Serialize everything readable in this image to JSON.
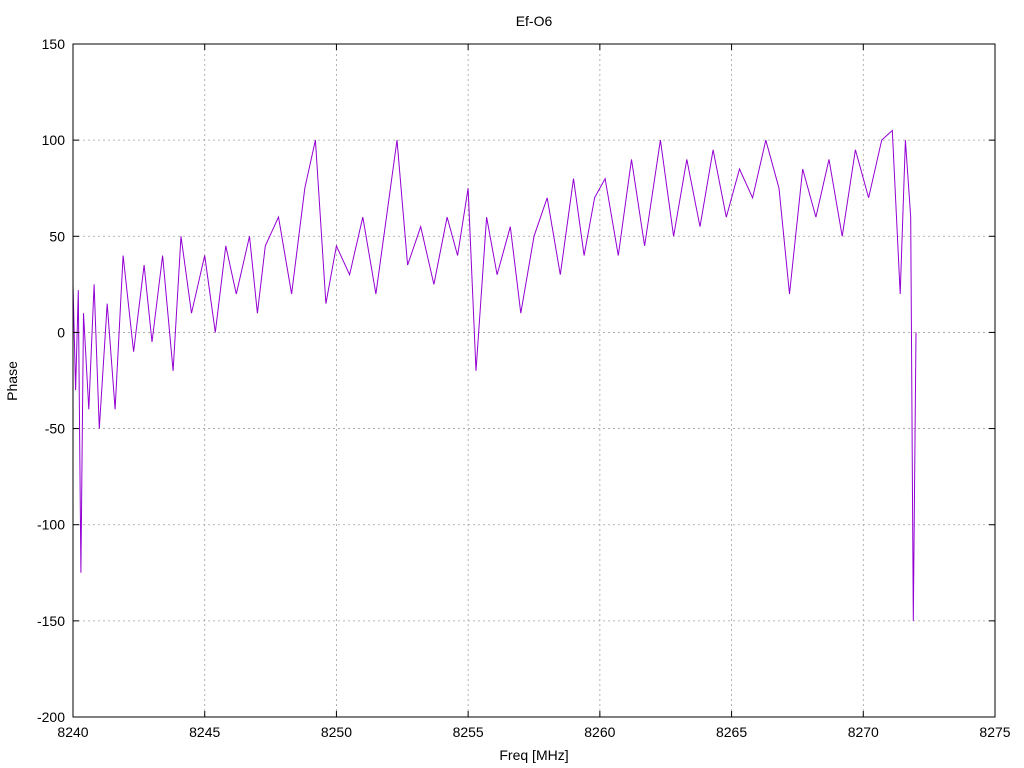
{
  "chart_data": {
    "type": "line",
    "title": "Ef-O6",
    "xlabel": "Freq [MHz]",
    "ylabel": "Phase",
    "xlim": [
      8240,
      8275
    ],
    "ylim": [
      -200,
      150
    ],
    "xticks": [
      8240,
      8245,
      8250,
      8255,
      8260,
      8265,
      8270,
      8275
    ],
    "yticks": [
      -200,
      -150,
      -100,
      -50,
      0,
      50,
      100,
      150
    ],
    "grid": true,
    "legend": "none",
    "series": [
      {
        "color": "#9400d3",
        "x": [
          8240.0,
          8240.1,
          8240.2,
          8240.3,
          8240.4,
          8240.6,
          8240.8,
          8241.0,
          8241.3,
          8241.6,
          8241.9,
          8242.3,
          8242.7,
          8243.0,
          8243.4,
          8243.8,
          8244.1,
          8244.5,
          8245.0,
          8245.4,
          8245.8,
          8246.2,
          8246.7,
          8247.0,
          8247.3,
          8247.8,
          8248.3,
          8248.8,
          8249.2,
          8249.6,
          8250.0,
          8250.5,
          8251.0,
          8251.5,
          8252.0,
          8252.3,
          8252.7,
          8253.2,
          8253.7,
          8254.2,
          8254.6,
          8255.0,
          8255.3,
          8255.7,
          8256.1,
          8256.6,
          8257.0,
          8257.5,
          8258.0,
          8258.5,
          8259.0,
          8259.4,
          8259.8,
          8260.2,
          8260.7,
          8261.2,
          8261.7,
          8262.3,
          8262.8,
          8263.3,
          8263.8,
          8264.3,
          8264.8,
          8265.3,
          8265.8,
          8266.3,
          8266.8,
          8267.2,
          8267.7,
          8268.2,
          8268.7,
          8269.2,
          8269.7,
          8270.2,
          8270.7,
          8271.1,
          8271.4,
          8271.6,
          8271.8,
          8271.9,
          8272.0
        ],
        "y": [
          25,
          -30,
          22,
          -125,
          10,
          -40,
          25,
          -50,
          15,
          -40,
          40,
          -10,
          35,
          -5,
          40,
          -20,
          50,
          10,
          40,
          0,
          45,
          20,
          50,
          10,
          45,
          60,
          20,
          75,
          100,
          15,
          45,
          30,
          60,
          20,
          70,
          100,
          35,
          55,
          25,
          60,
          40,
          75,
          -20,
          60,
          30,
          55,
          10,
          50,
          70,
          30,
          80,
          40,
          70,
          80,
          40,
          90,
          45,
          100,
          50,
          90,
          55,
          95,
          60,
          85,
          70,
          100,
          75,
          20,
          85,
          60,
          90,
          50,
          95,
          70,
          100,
          105,
          20,
          100,
          60,
          -150,
          0
        ]
      }
    ]
  }
}
